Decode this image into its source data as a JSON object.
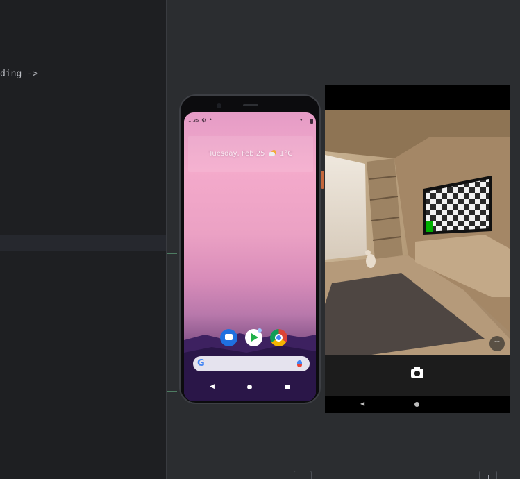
{
  "editor": {
    "code_fragment": "ding ->"
  },
  "phone": {
    "status_time": "1:35",
    "status_gear": "⚙",
    "status_dot": "•",
    "widget_date": "Tuesday, Feb 25",
    "widget_temp": "1°C",
    "search_g": "G",
    "nav_back": "◀"
  },
  "camera": {
    "more_label": "···",
    "nav_back": "◀"
  },
  "colors": {
    "editor_bg": "#1e1f22",
    "panel_bg": "#2b2d30",
    "accent_orange": "#c4673b",
    "green_marker": "#00b000"
  }
}
